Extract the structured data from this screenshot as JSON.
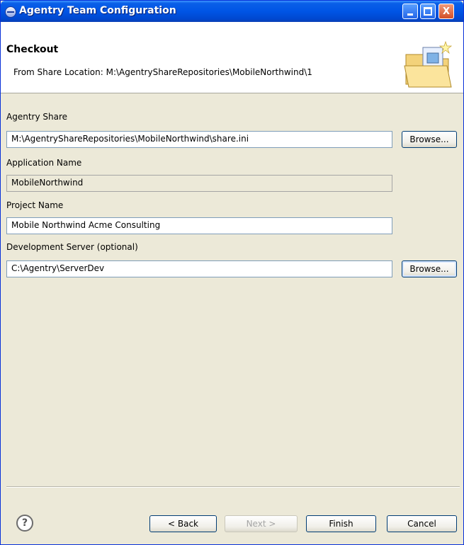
{
  "window": {
    "title": "Agentry Team Configuration",
    "controls": {
      "minimize": "_",
      "maximize": "□",
      "close": "X"
    }
  },
  "header": {
    "title": "Checkout",
    "description": "From Share Location: M:\\AgentryShareRepositories\\MobileNorthwind\\1",
    "icon": "open-folder-icon"
  },
  "form": {
    "agentry_share": {
      "label": "Agentry Share",
      "value": "M:\\AgentryShareRepositories\\MobileNorthwind\\share.ini",
      "browse": "Browse..."
    },
    "application_name": {
      "label": "Application Name",
      "value": "MobileNorthwind"
    },
    "project_name": {
      "label": "Project Name",
      "value": "Mobile Northwind Acme Consulting"
    },
    "development_server": {
      "label": "Development Server (optional)",
      "value": "C:\\Agentry\\ServerDev",
      "browse": "Browse..."
    }
  },
  "footer": {
    "help": "?",
    "back": "< Back",
    "next": "Next >",
    "finish": "Finish",
    "cancel": "Cancel"
  },
  "colors": {
    "titlebar": "#0055e5",
    "dialog_bg": "#ece9d8",
    "field_border": "#7f9db9"
  }
}
